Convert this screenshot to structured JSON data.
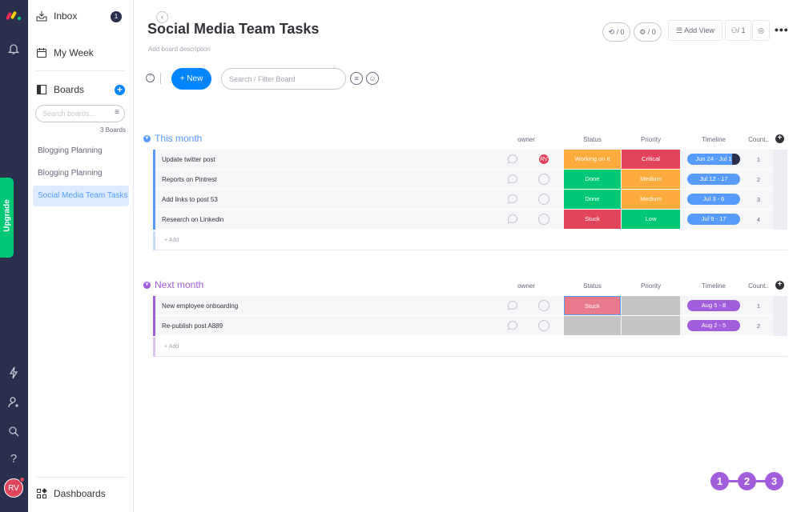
{
  "sidebar": {
    "inbox_label": "Inbox",
    "inbox_count": "1",
    "collapse_glyph": "‹",
    "my_week_label": "My Week",
    "boards_label": "Boards",
    "search_placeholder": "Search boards...",
    "boards_count": "3 Boards",
    "boards": [
      "Blogging Planning",
      "Blogging Planning",
      "Social Media Team Tasks"
    ],
    "dashboards_label": "Dashboards"
  },
  "rail": {
    "upgrade_label": "Upgrade",
    "user_initials": "RV"
  },
  "header": {
    "title": "Social Media Team Tasks",
    "description": "Add board description",
    "integrations_count": "/ 0",
    "automations_count": "/ 0",
    "add_view_label": "Add View",
    "members_count": "/ 1"
  },
  "toolbar": {
    "new_label": "+ New",
    "filter_placeholder": "Search / Filter Board"
  },
  "columns": {
    "owner": "owner",
    "status": "Status",
    "priority": "Priority",
    "timeline": "Timeline",
    "count": "Count.."
  },
  "colors": {
    "blue": "#579bfc",
    "purple": "#a25ddc",
    "orange": "#fdab3d",
    "green": "#00c875",
    "red": "#e2445c",
    "grey": "#c4c4c4"
  },
  "groups": [
    {
      "title": "This month",
      "color": "#579bfc",
      "add_label": "+ Add",
      "rows": [
        {
          "name": "Update twitter post",
          "owner": "RV",
          "status": "Working on it",
          "status_color": "#fdab3d",
          "priority": "Critical",
          "priority_color": "#e2445c",
          "timeline": "Jun 24 - Jul 1",
          "count": "1"
        },
        {
          "name": "Reports on Pintrest",
          "owner": "",
          "status": "Done",
          "status_color": "#00c875",
          "priority": "Medium",
          "priority_color": "#fdab3d",
          "timeline": "Jul 12 - 17",
          "count": "2"
        },
        {
          "name": "Add links to post 53",
          "owner": "",
          "status": "Done",
          "status_color": "#00c875",
          "priority": "Medium",
          "priority_color": "#fdab3d",
          "timeline": "Jul 3 - 6",
          "count": "3"
        },
        {
          "name": "Research on Linkedin",
          "owner": "",
          "status": "Stuck",
          "status_color": "#e2445c",
          "priority": "Low",
          "priority_color": "#00c875",
          "timeline": "Jul 9 - 17",
          "count": "4"
        }
      ]
    },
    {
      "title": "Next month",
      "color": "#a25ddc",
      "add_label": "+ Add",
      "rows": [
        {
          "name": "New employee onboarding",
          "owner": "",
          "status": "Stuck",
          "status_color": "#e2445c",
          "priority": "",
          "priority_color": "#c4c4c4",
          "timeline": "Aug 5 - 8",
          "count": "1"
        },
        {
          "name": "Re-publish post A889",
          "owner": "",
          "status": "",
          "status_color": "#c4c4c4",
          "priority": "",
          "priority_color": "#c4c4c4",
          "timeline": "Aug 2 - 5",
          "count": "2"
        }
      ]
    }
  ],
  "pager": [
    "1",
    "2",
    "3"
  ]
}
